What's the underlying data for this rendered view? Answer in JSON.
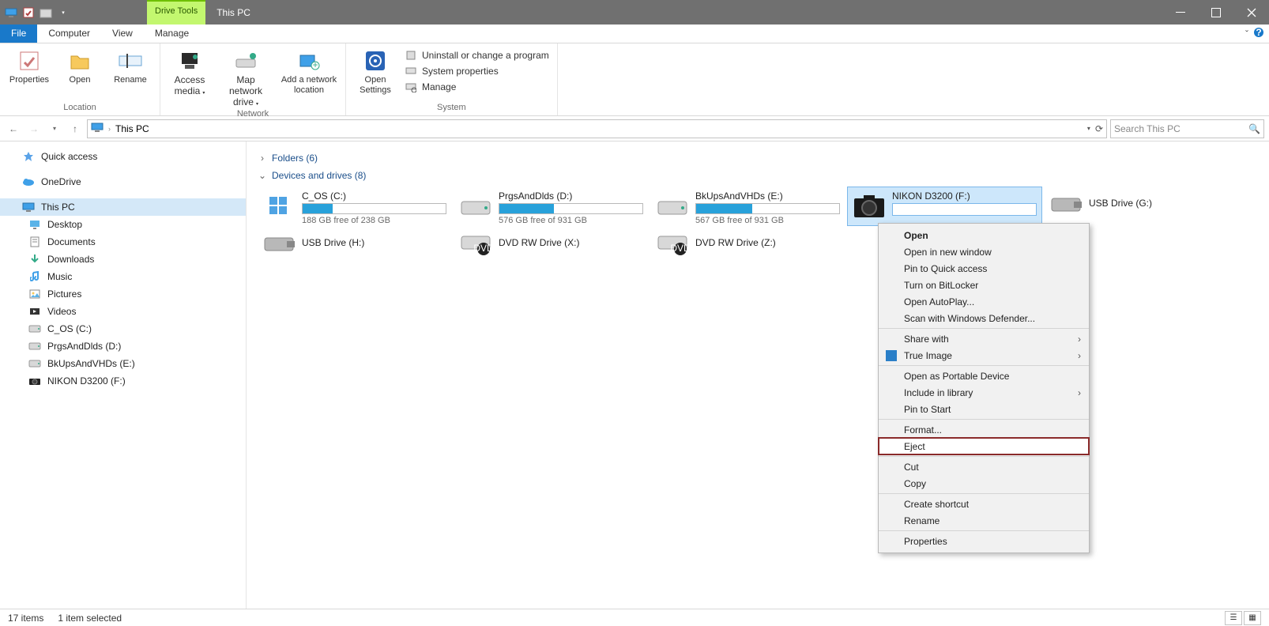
{
  "title": "This PC",
  "tool_tab": "Drive Tools",
  "tabs": {
    "file": "File",
    "computer": "Computer",
    "view": "View",
    "manage": "Manage"
  },
  "ribbon": {
    "location": {
      "label": "Location",
      "properties": "Properties",
      "open": "Open",
      "rename": "Rename"
    },
    "network": {
      "label": "Network",
      "access_media": "Access media",
      "map_drive": "Map network drive",
      "add_location": "Add a network location"
    },
    "system_group_label": "System",
    "open_settings": "Open Settings",
    "system": {
      "uninstall": "Uninstall or change a program",
      "properties": "System properties",
      "manage": "Manage"
    }
  },
  "nav": {
    "address": "This PC",
    "search_placeholder": "Search This PC"
  },
  "sidebar": [
    {
      "label": "Quick access",
      "icon": "star",
      "lvl": 0
    },
    {
      "sep": true
    },
    {
      "label": "OneDrive",
      "icon": "cloud",
      "lvl": 0
    },
    {
      "sep": true
    },
    {
      "label": "This PC",
      "icon": "pc",
      "lvl": 0,
      "selected": true
    },
    {
      "label": "Desktop",
      "icon": "desktop",
      "lvl": 1
    },
    {
      "label": "Documents",
      "icon": "doc",
      "lvl": 1
    },
    {
      "label": "Downloads",
      "icon": "down",
      "lvl": 1
    },
    {
      "label": "Music",
      "icon": "music",
      "lvl": 1
    },
    {
      "label": "Pictures",
      "icon": "pic",
      "lvl": 1
    },
    {
      "label": "Videos",
      "icon": "vid",
      "lvl": 1
    },
    {
      "label": "C_OS (C:)",
      "icon": "drive",
      "lvl": 1
    },
    {
      "label": "PrgsAndDlds (D:)",
      "icon": "drive",
      "lvl": 1
    },
    {
      "label": "BkUpsAndVHDs (E:)",
      "icon": "drive",
      "lvl": 1
    },
    {
      "label": "NIKON D3200 (F:)",
      "icon": "camera",
      "lvl": 1
    }
  ],
  "sections": {
    "folders": {
      "label": "Folders",
      "count": 6
    },
    "devices": {
      "label": "Devices and drives",
      "count": 8
    }
  },
  "drives": [
    {
      "name": "C_OS (C:)",
      "sub": "188 GB free of 238 GB",
      "fill": 21,
      "icon": "winlogo"
    },
    {
      "name": "PrgsAndDlds (D:)",
      "sub": "576 GB free of 931 GB",
      "fill": 38,
      "icon": "hdd"
    },
    {
      "name": "BkUpsAndVHDs (E:)",
      "sub": "567 GB free of 931 GB",
      "fill": 39,
      "icon": "hdd"
    },
    {
      "name": "NIKON D3200 (F:)",
      "selected": true,
      "icon": "camera",
      "rename": true
    },
    {
      "name": "USB Drive (G:)",
      "simple": true,
      "icon": "usb"
    },
    {
      "name": "USB Drive (H:)",
      "simple": true,
      "icon": "usb"
    },
    {
      "name": "DVD RW Drive (X:)",
      "simple": true,
      "icon": "dvd"
    },
    {
      "name": "DVD RW Drive (Z:)",
      "simple": true,
      "icon": "dvd"
    }
  ],
  "context": [
    [
      {
        "label": "Open",
        "bold": true
      },
      {
        "label": "Open in new window"
      },
      {
        "label": "Pin to Quick access"
      },
      {
        "label": "Turn on BitLocker"
      },
      {
        "label": "Open AutoPlay..."
      },
      {
        "label": "Scan with Windows Defender..."
      }
    ],
    [
      {
        "label": "Share with",
        "submenu": true
      },
      {
        "label": "True Image",
        "submenu": true,
        "icon": "trueimage"
      }
    ],
    [
      {
        "label": "Open as Portable Device"
      },
      {
        "label": "Include in library",
        "submenu": true
      },
      {
        "label": "Pin to Start"
      }
    ],
    [
      {
        "label": "Format..."
      },
      {
        "label": "Eject",
        "highlight": true
      }
    ],
    [
      {
        "label": "Cut"
      },
      {
        "label": "Copy"
      }
    ],
    [
      {
        "label": "Create shortcut"
      },
      {
        "label": "Rename"
      }
    ],
    [
      {
        "label": "Properties"
      }
    ]
  ],
  "status": {
    "items": "17 items",
    "selected": "1 item selected"
  }
}
